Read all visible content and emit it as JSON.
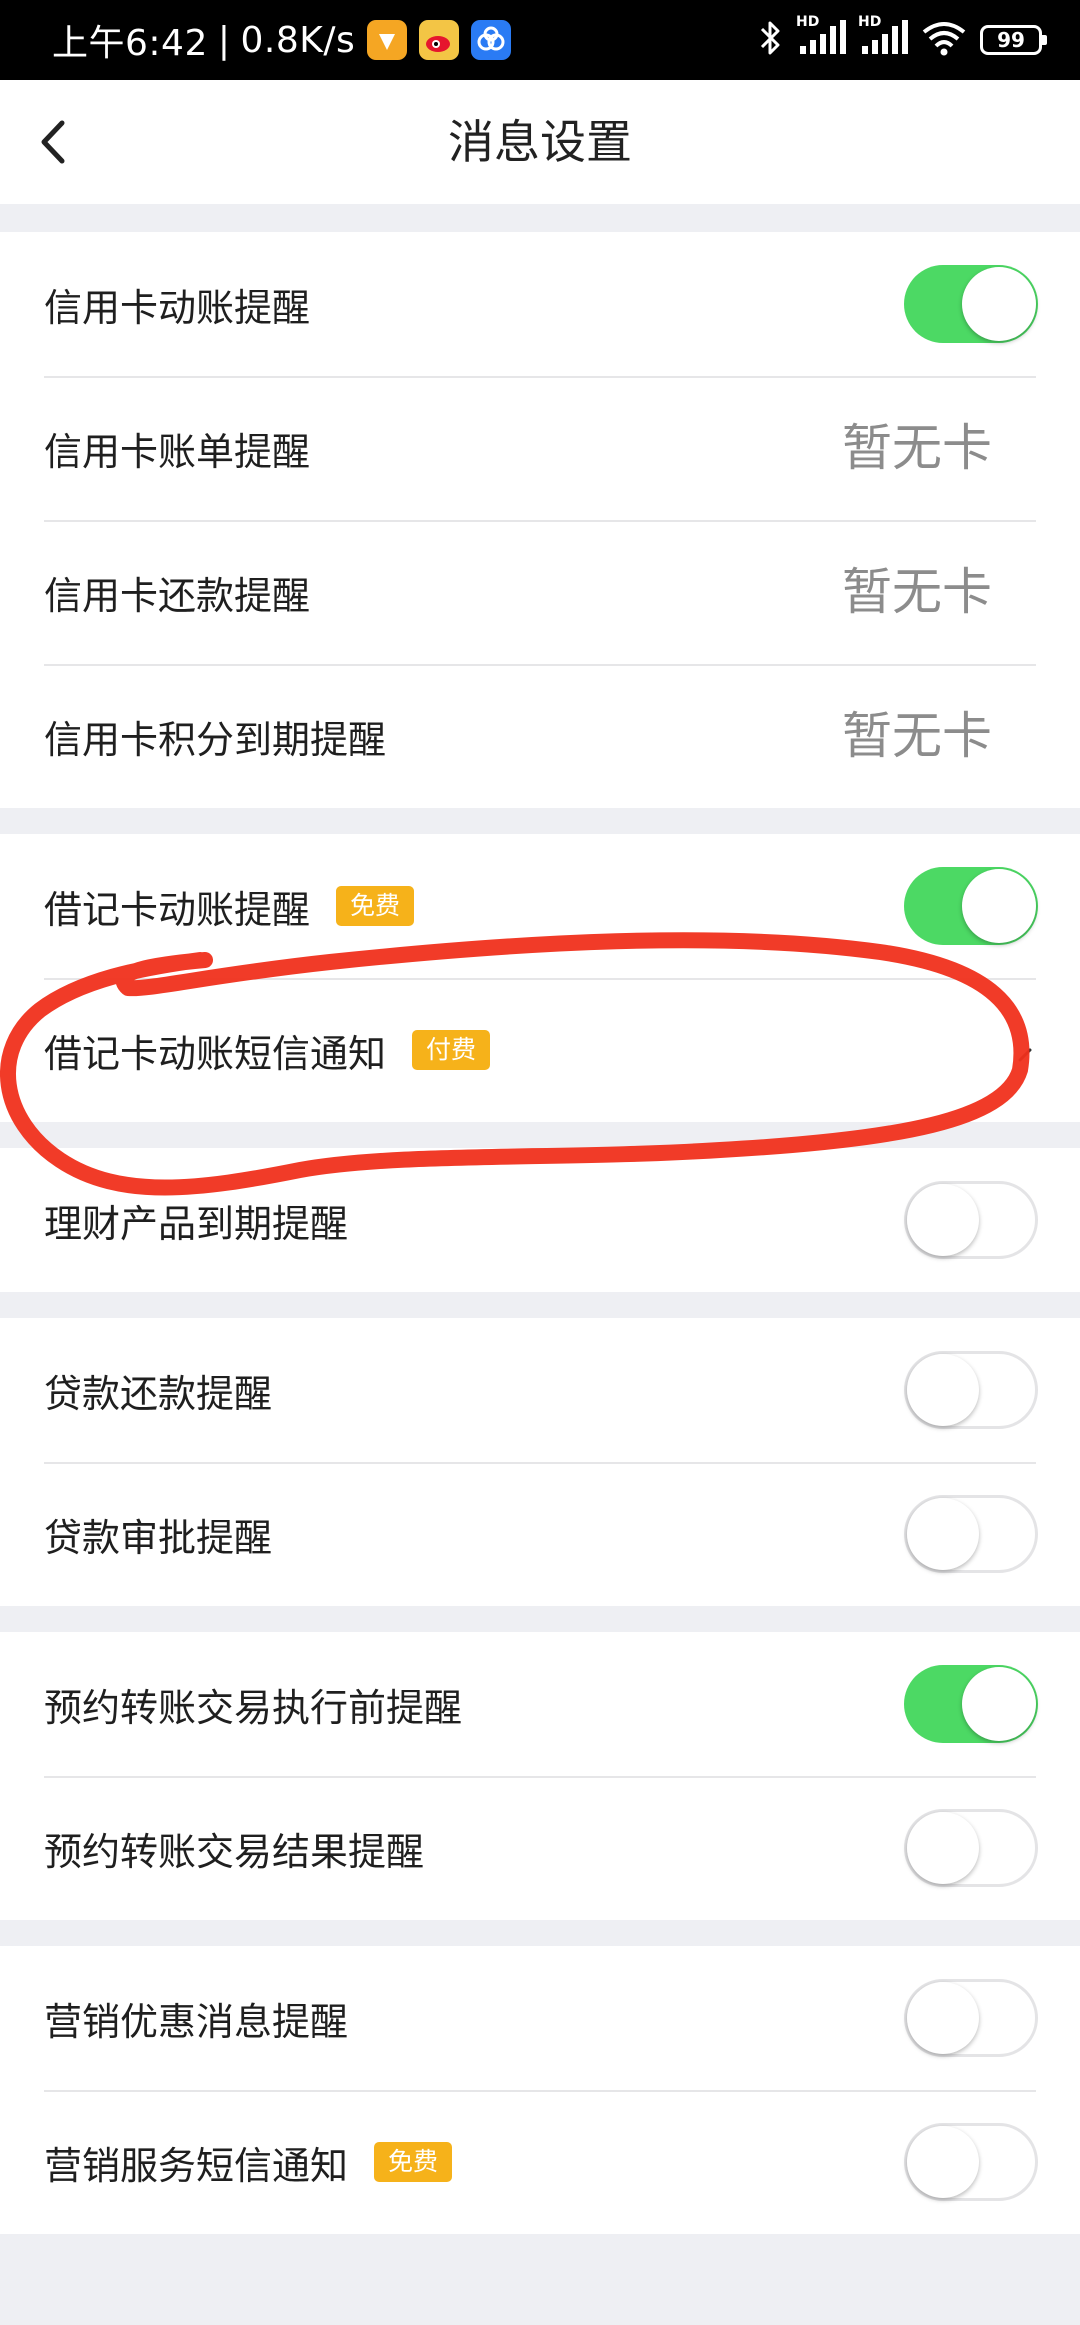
{
  "status_bar": {
    "time": "上午6:42",
    "separator": "|",
    "network_speed": "0.8K/s",
    "hd1": "HD",
    "hd2": "HD",
    "battery": "99"
  },
  "nav": {
    "title": "消息设置"
  },
  "groups": [
    {
      "rows": [
        {
          "label": "信用卡动账提醒",
          "toggle": "on"
        },
        {
          "label": "信用卡账单提醒",
          "value": "暂无卡"
        },
        {
          "label": "信用卡还款提醒",
          "value": "暂无卡"
        },
        {
          "label": "信用卡积分到期提醒",
          "value": "暂无卡"
        }
      ]
    },
    {
      "rows": [
        {
          "label": "借记卡动账提醒",
          "badge": "免费",
          "toggle": "on"
        },
        {
          "label": "借记卡动账短信通知",
          "badge": "付费"
        }
      ]
    },
    {
      "rows": [
        {
          "label": "理财产品到期提醒",
          "toggle": "off"
        }
      ]
    },
    {
      "rows": [
        {
          "label": "贷款还款提醒",
          "toggle": "off"
        },
        {
          "label": "贷款审批提醒",
          "toggle": "off"
        }
      ]
    },
    {
      "rows": [
        {
          "label": "预约转账交易执行前提醒",
          "toggle": "on"
        },
        {
          "label": "预约转账交易结果提醒",
          "toggle": "off"
        }
      ]
    },
    {
      "rows": [
        {
          "label": "营销优惠消息提醒",
          "toggle": "off"
        },
        {
          "label": "营销服务短信通知",
          "badge": "免费",
          "toggle": "off"
        }
      ]
    }
  ],
  "colors": {
    "toggle_on": "#4cd964",
    "badge": "#f6b21a",
    "annotation_stroke": "#f0301c",
    "page_background": "#eeeff3"
  },
  "icons": {
    "back": "chevron-left-icon",
    "bluetooth": "bluetooth-icon",
    "signal": "signal-icon",
    "wifi": "wifi-icon"
  }
}
